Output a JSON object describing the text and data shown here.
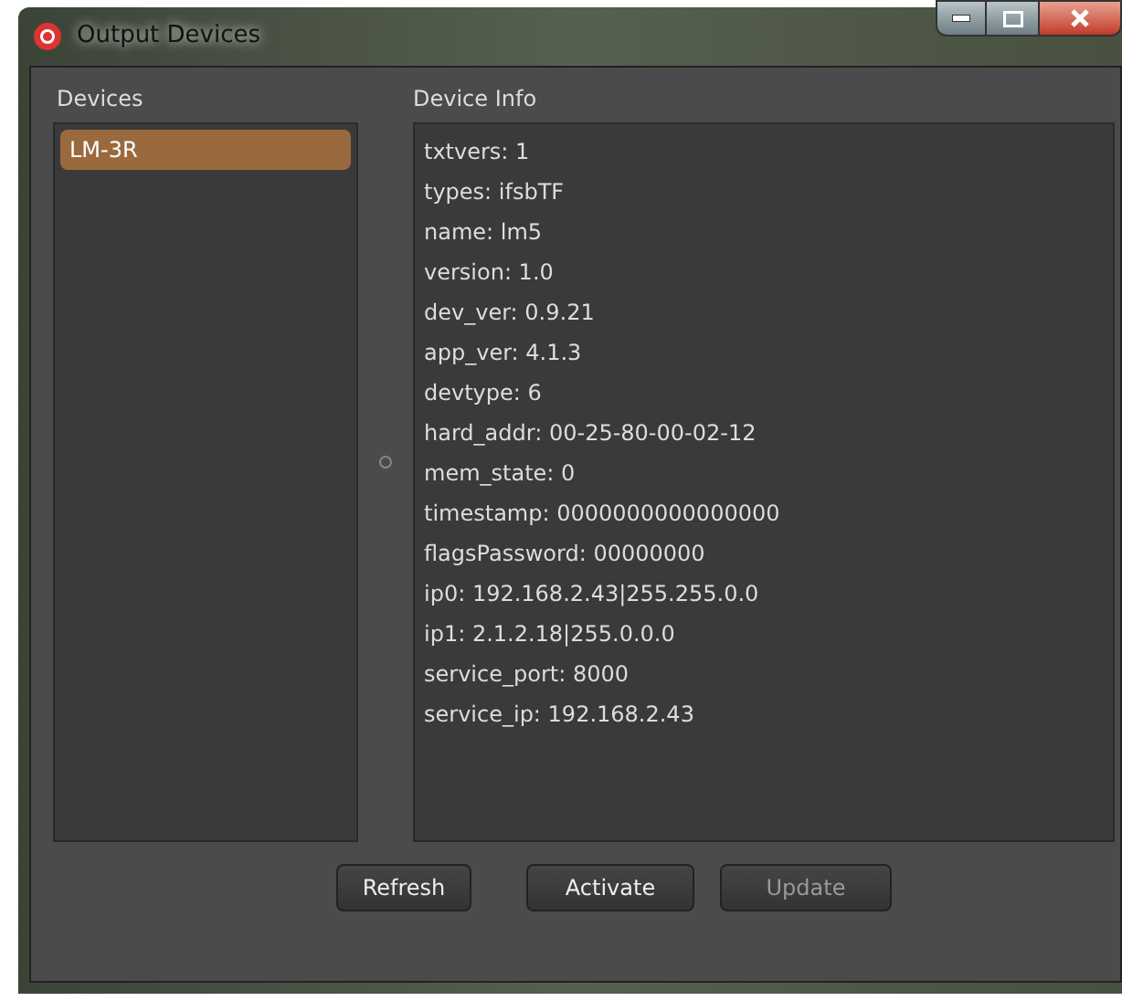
{
  "window": {
    "title": "Output Devices"
  },
  "devices": {
    "label": "Devices",
    "items": [
      {
        "name": "LM-3R",
        "selected": true
      }
    ]
  },
  "device_info": {
    "label": "Device Info",
    "lines": [
      "txtvers: 1",
      "types: ifsbTF",
      "name: lm5",
      "version: 1.0",
      "dev_ver: 0.9.21",
      "app_ver: 4.1.3",
      "devtype: 6",
      "hard_addr: 00-25-80-00-02-12",
      "mem_state: 0",
      "timestamp: 0000000000000000",
      "flagsPassword: 00000000",
      "ip0: 192.168.2.43|255.255.0.0",
      "ip1: 2.1.2.18|255.0.0.0",
      "service_port: 8000",
      "service_ip: 192.168.2.43"
    ]
  },
  "buttons": [
    {
      "label": "Refresh",
      "disabled": false
    },
    {
      "label": "Activate",
      "disabled": false
    },
    {
      "label": "Update",
      "disabled": true
    }
  ]
}
